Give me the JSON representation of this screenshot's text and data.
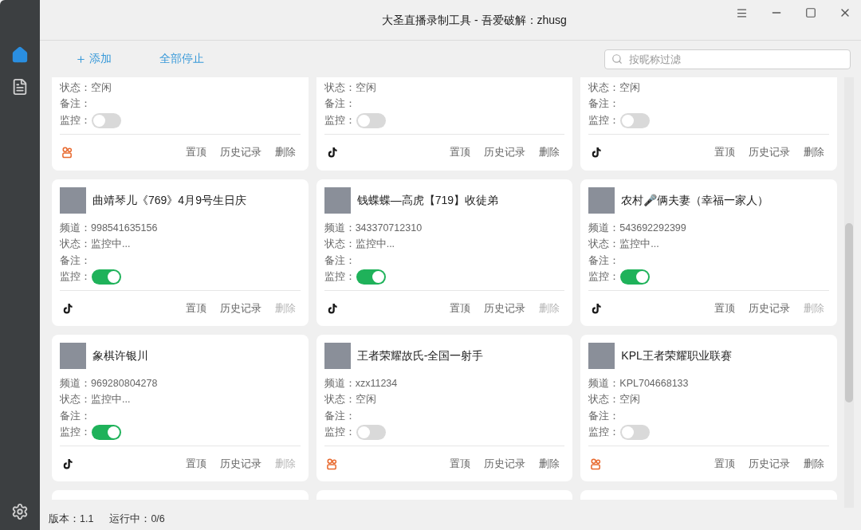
{
  "window": {
    "title": "大圣直播录制工具 - 吾爱破解：zhusg"
  },
  "sidebar": {
    "items": [
      {
        "kind": "home",
        "selected": true
      },
      {
        "kind": "log",
        "selected": false
      }
    ]
  },
  "toolbar": {
    "add": "添加",
    "stop_all": "全部停止",
    "search": {
      "placeholder": "按昵称过滤"
    }
  },
  "cards": [
    {
      "kind": "kuaishou",
      "fields": [
        {
          "label": "状态：",
          "value": "空闲"
        },
        {
          "label": "备注："
        }
      ],
      "monitor": {
        "label": "监控：",
        "on": false
      },
      "actions": [
        {
          "label": "置顶",
          "disabled": false
        },
        {
          "label": "历史记录",
          "disabled": false
        },
        {
          "label": "删除",
          "disabled": false
        }
      ]
    },
    {
      "kind": "douyin",
      "fields": [
        {
          "label": "状态：",
          "value": "空闲"
        },
        {
          "label": "备注："
        }
      ],
      "monitor": {
        "label": "监控：",
        "on": false
      },
      "actions": [
        {
          "label": "置顶",
          "disabled": false
        },
        {
          "label": "历史记录",
          "disabled": false
        },
        {
          "label": "删除",
          "disabled": false
        }
      ]
    },
    {
      "kind": "douyin",
      "fields": [
        {
          "label": "状态：",
          "value": "空闲"
        },
        {
          "label": "备注："
        }
      ],
      "monitor": {
        "label": "监控：",
        "on": false
      },
      "actions": [
        {
          "label": "置顶",
          "disabled": false
        },
        {
          "label": "历史记录",
          "disabled": false
        },
        {
          "label": "删除",
          "disabled": false
        }
      ]
    },
    {
      "name": "曲靖琴儿《769》4月9号生日庆",
      "kind": "douyin",
      "fields": [
        {
          "label": "频道：",
          "value": "998541635156"
        },
        {
          "label": "状态：",
          "value": "监控中..."
        },
        {
          "label": "备注："
        }
      ],
      "monitor": {
        "label": "监控：",
        "on": true
      },
      "actions": [
        {
          "label": "置顶",
          "disabled": false
        },
        {
          "label": "历史记录",
          "disabled": false
        },
        {
          "label": "删除",
          "disabled": true
        }
      ]
    },
    {
      "name": "钱蝶蝶—高虎【719】收徒弟",
      "kind": "douyin",
      "fields": [
        {
          "label": "频道：",
          "value": "343370712310"
        },
        {
          "label": "状态：",
          "value": "监控中..."
        },
        {
          "label": "备注："
        }
      ],
      "monitor": {
        "label": "监控：",
        "on": true
      },
      "actions": [
        {
          "label": "置顶",
          "disabled": false
        },
        {
          "label": "历史记录",
          "disabled": false
        },
        {
          "label": "删除",
          "disabled": true
        }
      ]
    },
    {
      "name": "农村🎤俩夫妻（幸福一家人）",
      "kind": "douyin",
      "fields": [
        {
          "label": "频道：",
          "value": "543692292399"
        },
        {
          "label": "状态：",
          "value": "监控中..."
        },
        {
          "label": "备注："
        }
      ],
      "monitor": {
        "label": "监控：",
        "on": true
      },
      "actions": [
        {
          "label": "置顶",
          "disabled": false
        },
        {
          "label": "历史记录",
          "disabled": false
        },
        {
          "label": "删除",
          "disabled": true
        }
      ]
    },
    {
      "name": "象棋许银川",
      "kind": "douyin",
      "fields": [
        {
          "label": "频道：",
          "value": "969280804278"
        },
        {
          "label": "状态：",
          "value": "监控中..."
        },
        {
          "label": "备注："
        }
      ],
      "monitor": {
        "label": "监控：",
        "on": true
      },
      "actions": [
        {
          "label": "置顶",
          "disabled": false
        },
        {
          "label": "历史记录",
          "disabled": false
        },
        {
          "label": "删除",
          "disabled": true
        }
      ]
    },
    {
      "name": "王者荣耀故氏-全国一射手",
      "kind": "kuaishou",
      "fields": [
        {
          "label": "频道：",
          "value": "xzx11234"
        },
        {
          "label": "状态：",
          "value": "空闲"
        },
        {
          "label": "备注："
        }
      ],
      "monitor": {
        "label": "监控：",
        "on": false
      },
      "actions": [
        {
          "label": "置顶",
          "disabled": false
        },
        {
          "label": "历史记录",
          "disabled": false
        },
        {
          "label": "删除",
          "disabled": false
        }
      ]
    },
    {
      "name": "KPL王者荣耀职业联赛",
      "kind": "kuaishou",
      "fields": [
        {
          "label": "频道：",
          "value": "KPL704668133"
        },
        {
          "label": "状态：",
          "value": "空闲"
        },
        {
          "label": "备注："
        }
      ],
      "monitor": {
        "label": "监控：",
        "on": false
      },
      "actions": [
        {
          "label": "置顶",
          "disabled": false
        },
        {
          "label": "历史记录",
          "disabled": false
        },
        {
          "label": "删除",
          "disabled": false
        }
      ]
    }
  ],
  "status_bar": {
    "version": "版本：1.1",
    "running": "运行中：0/6"
  }
}
